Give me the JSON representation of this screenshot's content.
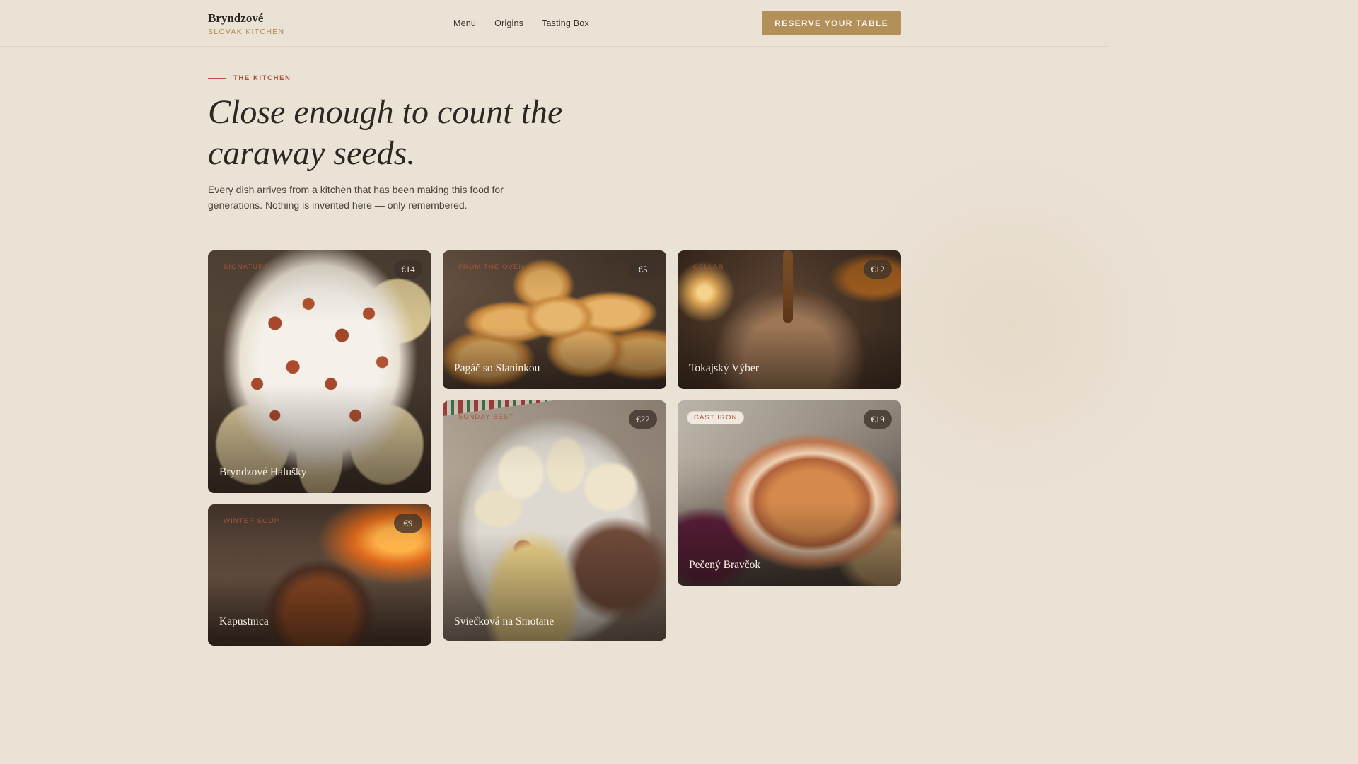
{
  "header": {
    "brand_name": "Bryndzové",
    "brand_sub": "SLOVAK KITCHEN",
    "nav": [
      "Menu",
      "Origins",
      "Tasting Box"
    ],
    "cta": "RESERVE YOUR TABLE"
  },
  "hero": {
    "eyebrow": "THE KITCHEN",
    "title": "Close enough to count the caraway seeds.",
    "lede": "Every dish arrives from a kitchen that has been making this food for generations. Nothing is invented here — only remembered."
  },
  "dishes": [
    {
      "tag": "SIGNATURE",
      "price": "€14",
      "name": "Bryndzové Halušky"
    },
    {
      "tag": "FROM THE OVEN",
      "price": "€5",
      "name": "Pagáč so Slaninkou"
    },
    {
      "tag": "CELLAR",
      "price": "€12",
      "name": "Tokajský Výber"
    },
    {
      "tag": "SUNDAY BEST",
      "price": "€22",
      "name": "Sviečková na Smotane"
    },
    {
      "tag": "CAST IRON",
      "price": "€19",
      "name": "Pečený Bravčok"
    },
    {
      "tag": "WINTER SOUP",
      "price": "€9",
      "name": "Kapustnica"
    }
  ],
  "colors": {
    "background": "#ebe2d6",
    "accent": "#b3905a",
    "eyebrow": "#a85538"
  }
}
